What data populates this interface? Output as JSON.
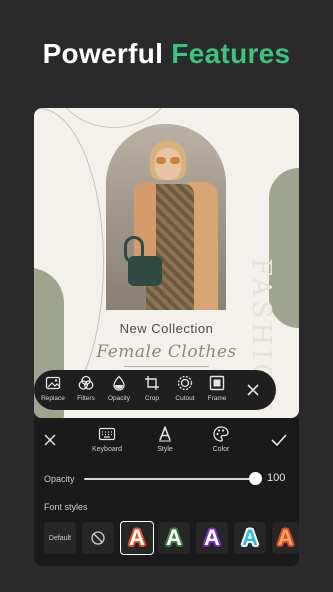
{
  "headline": {
    "white": "Powerful",
    "green": "Features"
  },
  "poster": {
    "collection": "New Collection",
    "title": "Female Clothes",
    "side_text": "FASHION"
  },
  "toolbar": {
    "items": [
      {
        "label": "Replace",
        "icon": "image-icon"
      },
      {
        "label": "Filters",
        "icon": "filters-icon"
      },
      {
        "label": "Opacity",
        "icon": "drop-icon"
      },
      {
        "label": "Crop",
        "icon": "crop-icon"
      },
      {
        "label": "Cutout",
        "icon": "cutout-icon"
      },
      {
        "label": "Frame",
        "icon": "frame-icon"
      }
    ]
  },
  "panel": {
    "tabs": [
      {
        "label": "Keyboard",
        "icon": "keyboard-icon"
      },
      {
        "label": "Style",
        "icon": "text-style-icon"
      },
      {
        "label": "Color",
        "icon": "palette-icon"
      }
    ],
    "opacity_label": "Opacity",
    "opacity_value": "100",
    "opacity_fraction": 1.0,
    "font_styles_label": "Font styles",
    "default_label": "Default",
    "styles": [
      {
        "letter": "A",
        "fill": "#ffffff",
        "outline": "#e0542a",
        "selected": true
      },
      {
        "letter": "A",
        "fill": "#ffffff",
        "outline": "#3a7a3a",
        "selected": false
      },
      {
        "letter": "A",
        "fill": "#ffffff",
        "outline": "#7b2fbf",
        "selected": false
      },
      {
        "letter": "A",
        "fill": "#2bbde8",
        "outline": "#ffffff",
        "selected": false
      },
      {
        "letter": "A",
        "fill": "#f2a65a",
        "outline": "#d24a2a",
        "selected": false
      }
    ]
  },
  "colors": {
    "accent": "#3cc47c",
    "background": "#2a2a2a"
  }
}
